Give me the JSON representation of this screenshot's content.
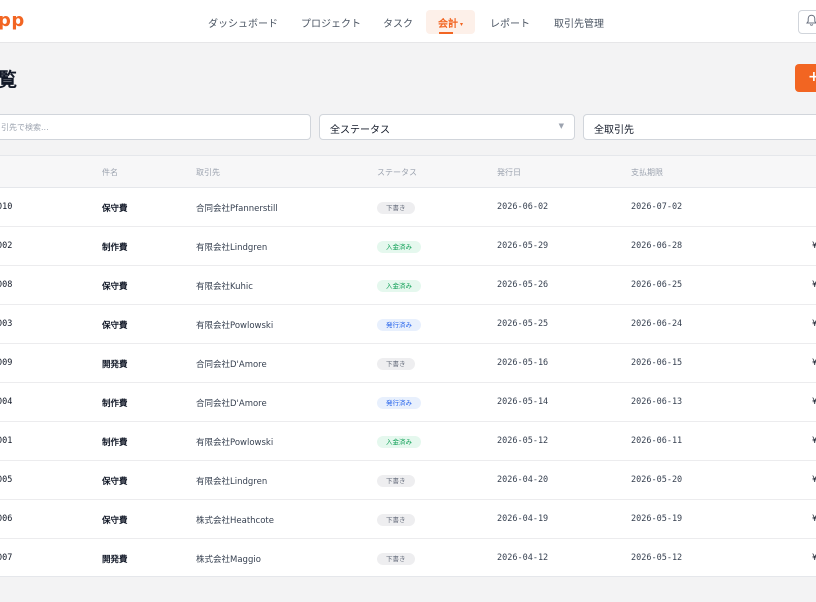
{
  "app": {
    "brand": "pp"
  },
  "nav": {
    "items": [
      {
        "label": "ダッシュボード",
        "active": false
      },
      {
        "label": "プロジェクト",
        "active": false
      },
      {
        "label": "タスク",
        "active": false
      },
      {
        "label": "会計",
        "active": true
      },
      {
        "label": "レポート",
        "active": false
      },
      {
        "label": "取引先管理",
        "active": false
      }
    ],
    "bell_icon": "bell-icon"
  },
  "page": {
    "title": "覧",
    "add_label": "+"
  },
  "filters": {
    "search_placeholder": "引先で検索...",
    "status_value": "全ステータス",
    "client_value": "全取引先"
  },
  "table": {
    "headers": [
      "件名",
      "取引先",
      "ステータス",
      "発行日",
      "支払期限"
    ],
    "rows": [
      {
        "no": "010",
        "name": "保守費",
        "client": "合同会社Pfannerstill",
        "status": "下書き",
        "status_kind": "draft",
        "issued": "2026-06-02",
        "due": "2026-07-02",
        "amount": ""
      },
      {
        "no": "002",
        "name": "制作費",
        "client": "有限会社Lindgren",
        "status": "入金済み",
        "status_kind": "paid",
        "issued": "2026-05-29",
        "due": "2026-06-28",
        "amount": "¥"
      },
      {
        "no": "008",
        "name": "保守費",
        "client": "有限会社Kuhic",
        "status": "入金済み",
        "status_kind": "paid",
        "issued": "2026-05-26",
        "due": "2026-06-25",
        "amount": "¥"
      },
      {
        "no": "003",
        "name": "保守費",
        "client": "有限会社Powlowski",
        "status": "発行済み",
        "status_kind": "issued",
        "issued": "2026-05-25",
        "due": "2026-06-24",
        "amount": "¥"
      },
      {
        "no": "009",
        "name": "開発費",
        "client": "合同会社D'Amore",
        "status": "下書き",
        "status_kind": "draft",
        "issued": "2026-05-16",
        "due": "2026-06-15",
        "amount": "¥"
      },
      {
        "no": "004",
        "name": "制作費",
        "client": "合同会社D'Amore",
        "status": "発行済み",
        "status_kind": "issued",
        "issued": "2026-05-14",
        "due": "2026-06-13",
        "amount": "¥"
      },
      {
        "no": "001",
        "name": "制作費",
        "client": "有限会社Powlowski",
        "status": "入金済み",
        "status_kind": "paid",
        "issued": "2026-05-12",
        "due": "2026-06-11",
        "amount": "¥"
      },
      {
        "no": "005",
        "name": "保守費",
        "client": "有限会社Lindgren",
        "status": "下書き",
        "status_kind": "draft",
        "issued": "2026-04-20",
        "due": "2026-05-20",
        "amount": "¥"
      },
      {
        "no": "006",
        "name": "保守費",
        "client": "株式会社Heathcote",
        "status": "下書き",
        "status_kind": "draft",
        "issued": "2026-04-19",
        "due": "2026-05-19",
        "amount": "¥"
      },
      {
        "no": "007",
        "name": "開発費",
        "client": "株式会社Maggio",
        "status": "下書き",
        "status_kind": "draft",
        "issued": "2026-04-12",
        "due": "2026-05-12",
        "amount": "¥"
      }
    ]
  },
  "colors": {
    "accent": "#f26522",
    "paid": "#0f9f56",
    "issued": "#2563eb",
    "draft": "#6b7280"
  }
}
